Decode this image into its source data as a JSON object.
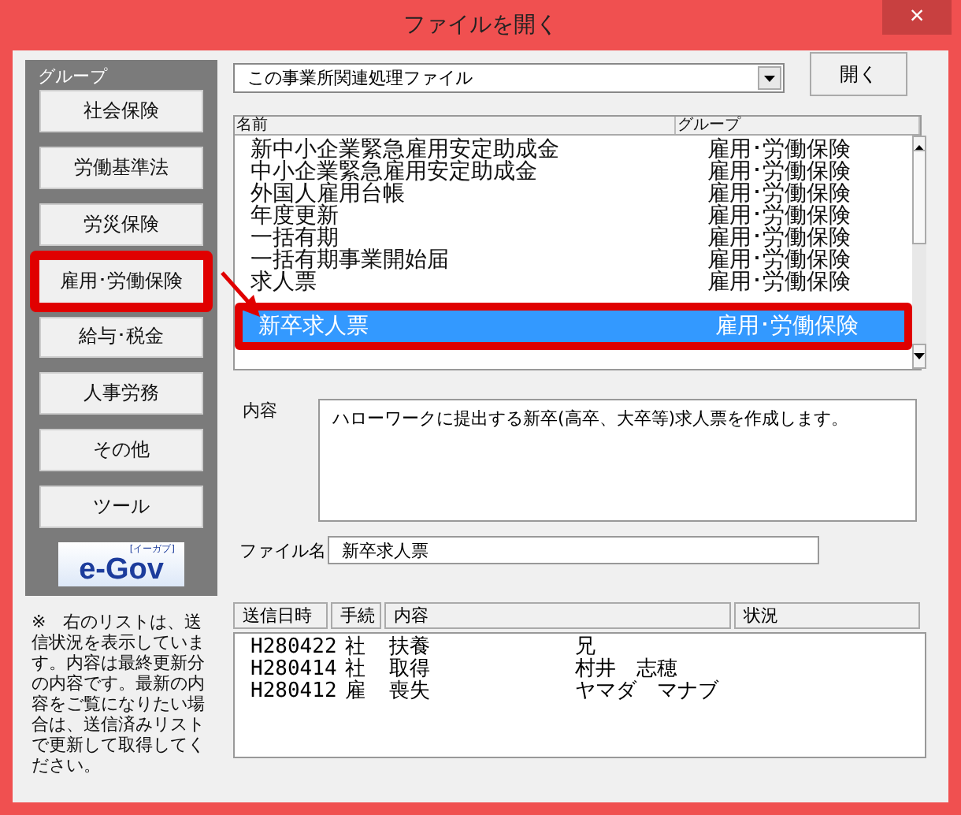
{
  "window": {
    "title": "ファイルを開く",
    "close": "×"
  },
  "group_panel": {
    "title": "グループ",
    "buttons": [
      {
        "label": "社会保険",
        "highlighted": false
      },
      {
        "label": "労働基準法",
        "highlighted": false
      },
      {
        "label": "労災保険",
        "highlighted": false
      },
      {
        "label": "雇用･労働保険",
        "highlighted": true
      },
      {
        "label": "給与･税金",
        "highlighted": false
      },
      {
        "label": "人事労務",
        "highlighted": false
      },
      {
        "label": "その他",
        "highlighted": false
      },
      {
        "label": "ツール",
        "highlighted": false
      }
    ],
    "logo": {
      "text": "e-Gov",
      "subtext": "[イーガブ]"
    }
  },
  "category_dropdown": {
    "value": "この事業所関連処理ファイル"
  },
  "open_button": "開く",
  "file_list": {
    "columns": [
      "名前",
      "グループ"
    ],
    "rows": [
      {
        "name": "新中小企業緊急雇用安定助成金",
        "group": "雇用･労働保険",
        "selected": false
      },
      {
        "name": "中小企業緊急雇用安定助成金",
        "group": "雇用･労働保険",
        "selected": false
      },
      {
        "name": "外国人雇用台帳",
        "group": "雇用･労働保険",
        "selected": false
      },
      {
        "name": "年度更新",
        "group": "雇用･労働保険",
        "selected": false
      },
      {
        "name": "一括有期",
        "group": "雇用･労働保険",
        "selected": false
      },
      {
        "name": "一括有期事業開始届",
        "group": "雇用･労働保険",
        "selected": false
      },
      {
        "name": "求人票",
        "group": "雇用･労働保険",
        "selected": false
      },
      {
        "name": "新卒求人票",
        "group": "雇用･労働保険",
        "selected": true
      }
    ]
  },
  "content": {
    "label": "内容",
    "value": "ハローワークに提出する新卒(高卒、大卒等)求人票を作成します。"
  },
  "file_name": {
    "label": "ファイル名",
    "value": "新卒求人票"
  },
  "note": "※　右のリストは、送信状況を表示しています。内容は最終更新分の内容です。最新の内容をご覧になりたい場合は、送信済みリストで更新して取得してください。",
  "send_table": {
    "columns": [
      "送信日時",
      "手続",
      "内容",
      "状況"
    ],
    "rows": [
      {
        "date": "H280422",
        "proc": "社",
        "content": "扶養",
        "person": "兄"
      },
      {
        "date": "H280414",
        "proc": "社",
        "content": "取得",
        "person": "村井　志穂"
      },
      {
        "date": "H280412",
        "proc": "雇",
        "content": "喪失",
        "person": "ヤマダ　マナブ"
      }
    ]
  }
}
